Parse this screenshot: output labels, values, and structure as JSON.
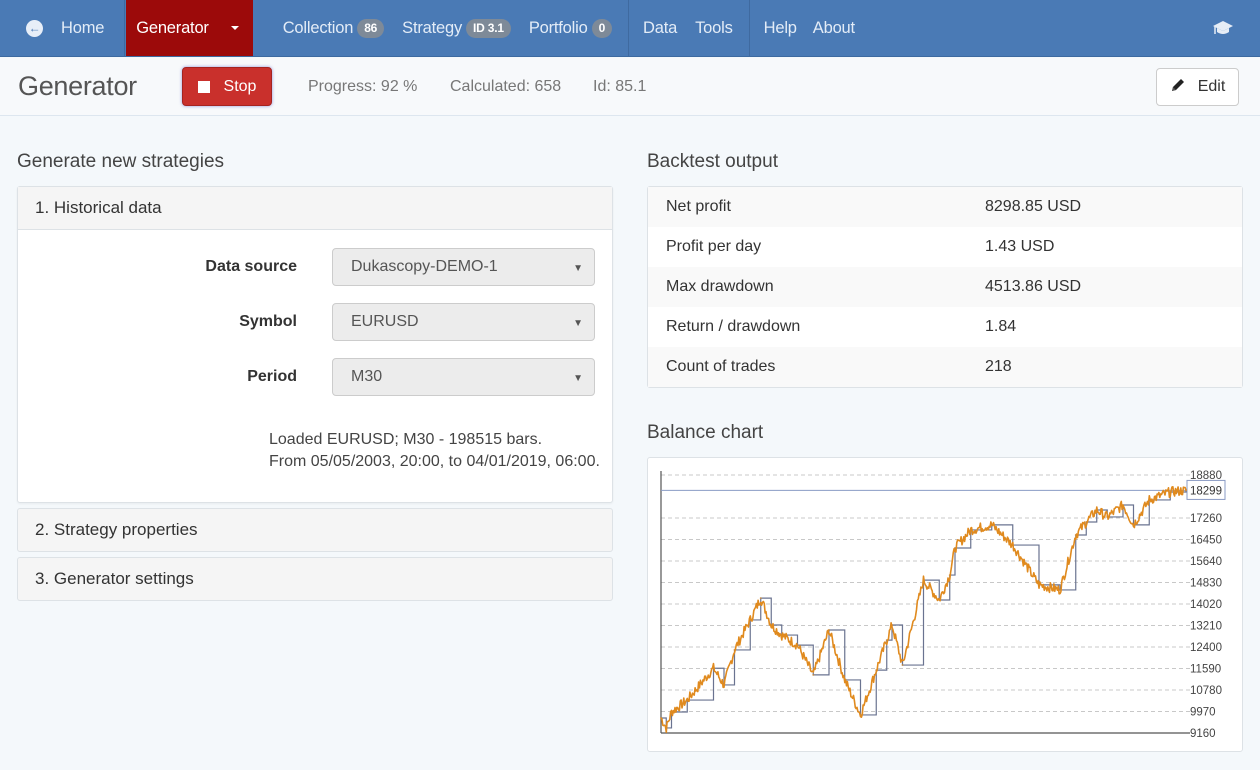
{
  "navbar": {
    "items": [
      {
        "label": "Home",
        "icon": "arrow-circle-left-icon"
      },
      {
        "label": "Generator",
        "active": true,
        "has_dropdown": true
      },
      {
        "label": "Collection",
        "badge": "86"
      },
      {
        "label": "Strategy",
        "badge": "ID 3.1"
      },
      {
        "label": "Portfolio",
        "badge": "0"
      },
      {
        "label": "Data"
      },
      {
        "label": "Tools"
      },
      {
        "label": "Help"
      },
      {
        "label": "About"
      }
    ],
    "right_icon": "graduation-cap-icon",
    "active_color": "#9c0a0a",
    "bar_color": "#4a7ab5"
  },
  "toolbar": {
    "title": "Generator",
    "stop_label": "Stop",
    "progress": "Progress: 92 %",
    "calculated": "Calculated: 658",
    "id": "Id: 85.1",
    "edit_label": "Edit"
  },
  "generate": {
    "title": "Generate new strategies",
    "historical": {
      "heading": "1. Historical data",
      "fields": [
        {
          "label": "Data source",
          "value": "Dukascopy-DEMO-1"
        },
        {
          "label": "Symbol",
          "value": "EURUSD"
        },
        {
          "label": "Period",
          "value": "M30"
        }
      ],
      "info_line1": "Loaded EURUSD; M30 - 198515 bars.",
      "info_line2": "From 05/05/2003, 20:00, to 04/01/2019, 06:00."
    },
    "strategy_properties": "2. Strategy properties",
    "generator_settings": "3. Generator settings"
  },
  "backtest": {
    "title": "Backtest output",
    "rows": [
      {
        "label": "Net profit",
        "value": "8298.85 USD"
      },
      {
        "label": "Profit per day",
        "value": "1.43 USD"
      },
      {
        "label": "Max drawdown",
        "value": "4513.86 USD"
      },
      {
        "label": "Return / drawdown",
        "value": "1.84"
      },
      {
        "label": "Count of trades",
        "value": "218"
      }
    ]
  },
  "balance": {
    "title": "Balance chart"
  },
  "chart_data": {
    "type": "line",
    "title": "Balance chart",
    "xlabel": "",
    "ylabel": "",
    "ylim": [
      9160,
      18880
    ],
    "yticks": [
      9160,
      9970,
      10780,
      11590,
      12400,
      13210,
      14020,
      14830,
      15640,
      16450,
      17260,
      18880
    ],
    "current_value_label": 18299,
    "grid": true,
    "series": [
      {
        "name": "Balance",
        "color": "#e08a1e",
        "x": [
          0,
          1,
          2,
          5,
          10,
          12,
          14,
          17,
          19,
          21,
          23,
          26,
          29,
          32,
          35,
          38,
          41,
          43,
          44,
          46,
          50,
          53,
          55,
          56,
          59,
          63,
          67,
          72,
          76,
          79,
          81,
          83,
          85,
          88,
          90,
          93,
          97,
          100
        ],
        "values": [
          9725,
          9350,
          9950,
          10400,
          11600,
          10970,
          12290,
          13420,
          14240,
          13230,
          12850,
          12470,
          11350,
          13040,
          11160,
          9840,
          11530,
          12660,
          13230,
          11720,
          14920,
          14170,
          15110,
          16130,
          16810,
          17000,
          16240,
          14740,
          14550,
          16620,
          17110,
          17560,
          17300,
          17750,
          17000,
          17940,
          18240,
          18299
        ]
      }
    ]
  }
}
